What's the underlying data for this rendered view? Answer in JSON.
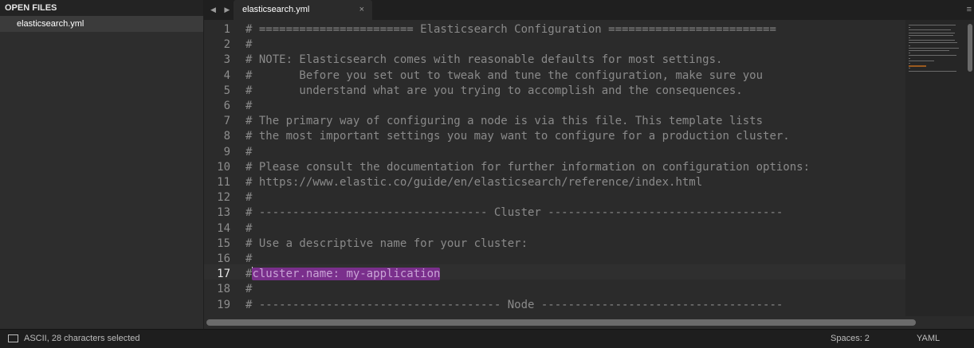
{
  "sidebar": {
    "header": "OPEN FILES",
    "files": [
      "elasticsearch.yml"
    ]
  },
  "tabs": {
    "nav": "◀ ▶",
    "active": {
      "label": "elasticsearch.yml",
      "close": "×"
    },
    "menu": "≡"
  },
  "editor": {
    "active_line": 17,
    "lines": [
      {
        "n": "1",
        "text": "# ======================= Elasticsearch Configuration ========================="
      },
      {
        "n": "2",
        "text": "#"
      },
      {
        "n": "3",
        "text": "# NOTE: Elasticsearch comes with reasonable defaults for most settings."
      },
      {
        "n": "4",
        "text": "#       Before you set out to tweak and tune the configuration, make sure you"
      },
      {
        "n": "5",
        "text": "#       understand what are you trying to accomplish and the consequences."
      },
      {
        "n": "6",
        "text": "#"
      },
      {
        "n": "7",
        "text": "# The primary way of configuring a node is via this file. This template lists"
      },
      {
        "n": "8",
        "text": "# the most important settings you may want to configure for a production cluster."
      },
      {
        "n": "9",
        "text": "#"
      },
      {
        "n": "10",
        "text": "# Please consult the documentation for further information on configuration options:"
      },
      {
        "n": "11",
        "text": "# https://www.elastic.co/guide/en/elasticsearch/reference/index.html"
      },
      {
        "n": "12",
        "text": "#"
      },
      {
        "n": "13",
        "text": "# ---------------------------------- Cluster -----------------------------------"
      },
      {
        "n": "14",
        "text": "#"
      },
      {
        "n": "15",
        "text": "# Use a descriptive name for your cluster:"
      },
      {
        "n": "16",
        "text": "#"
      },
      {
        "n": "17",
        "prefix": "#",
        "selected": "cluster.name: my-application"
      },
      {
        "n": "18",
        "text": "#"
      },
      {
        "n": "19",
        "text": "# ------------------------------------ Node ------------------------------------"
      }
    ]
  },
  "status": {
    "selection": "ASCII, 28 characters selected",
    "indent": "Spaces: 2",
    "syntax": "YAML"
  },
  "colors": {
    "selection": "#7a2f8c",
    "background": "#2b2b2b"
  }
}
